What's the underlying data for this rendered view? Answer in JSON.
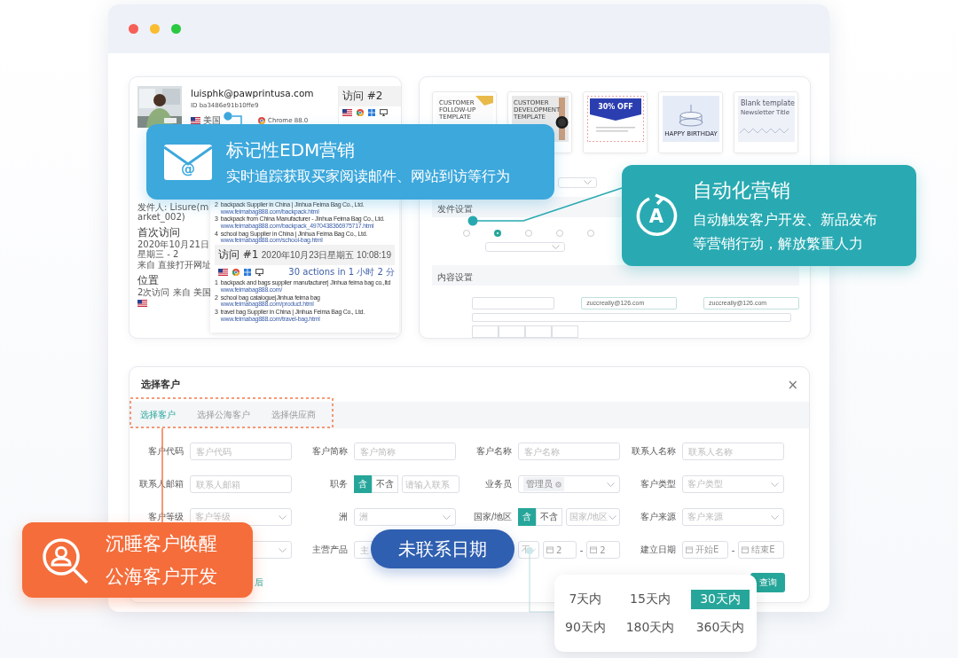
{
  "window": {
    "controls": [
      {
        "color": "#f65f57"
      },
      {
        "color": "#f9bd2f"
      },
      {
        "color": "#2ac940"
      }
    ]
  },
  "visitor_panel": {
    "email": "luisphk@pawprintusa.com",
    "id": "ID ba3486e91b10ffe9",
    "country": "美国",
    "browser": "Chrome 88.0",
    "sender": "发件人: Lisure(market_002)",
    "sections": [
      {
        "title": "首次访问",
        "lines": [
          "2020年10月21日星期三 - 2",
          "来自 直接打开网址"
        ],
        "flag": false
      },
      {
        "title": "位置",
        "lines": [
          "2次访问 来自 美国"
        ],
        "flag": true
      }
    ],
    "visit_2": {
      "title": "访问 #2"
    },
    "pages_top": [
      {
        "index": "2",
        "title": "backpack Supplier in China | Jinhua Feima Bag Co., Ltd.",
        "url": "www.feimabag888.com/backpack.html"
      },
      {
        "index": "3",
        "title": "backpack from China Manufacturer - Jinhua Feima Bag Co., Ltd.",
        "url": "www.feimabag888.com/backpack_4970438366975717.html"
      },
      {
        "index": "4",
        "title": "school bag Supplier in China | Jinhua Feima Bag Co., Ltd.",
        "url": "www.feimabag888.com/school-bag.html"
      }
    ],
    "visit_1": {
      "title": "访问 #1",
      "date": "2020年10月23日星期五 10:08:19",
      "summary": "30 actions in 1 小时 2 分",
      "pages": [
        {
          "index": "1",
          "title": "backpack and bags supplier manufacturer| Jinhua feima bag co.,ltd",
          "url": "www.feimabag888.com/"
        },
        {
          "index": "2",
          "title": "school bag catalogue|Jinhua feima bag",
          "url": "www.feimabag888.com/product.html"
        },
        {
          "index": "3",
          "title": "travel bag Supplier in China | Jinhua Feima Bag Co., Ltd.",
          "url": "www.feimabag888.com/travel-bag.html"
        }
      ]
    }
  },
  "campaign_panel": {
    "templates": [
      {
        "kind": "followup",
        "texts": [
          "CUSTOMER",
          "FOLLOW-UP",
          "TEMPLATE"
        ]
      },
      {
        "kind": "development",
        "texts": [
          "CUSTOMER",
          "DEVELOPMENT",
          "TEMPLATE"
        ]
      },
      {
        "kind": "sale",
        "texts": [
          "30% OFF"
        ]
      },
      {
        "kind": "birthday",
        "texts": [
          "HAPPY BIRTHDAY"
        ]
      },
      {
        "kind": "blank",
        "texts": [
          "Blank template",
          "Newsletter Title"
        ]
      }
    ],
    "sections": [
      {
        "title": "发件设置"
      },
      {
        "title": "内容设置"
      }
    ],
    "radios": [
      {
        "selected": false
      },
      {
        "selected": true
      },
      {
        "selected": false
      },
      {
        "selected": false
      },
      {
        "selected": false
      }
    ],
    "sender_addresses": [
      "zuccreally@126.com",
      "zuccreally@126.com"
    ]
  },
  "customer_dialog": {
    "title": "选择客户",
    "close": "×",
    "tabs": [
      {
        "label": "选择客户",
        "selected": true
      },
      {
        "label": "选择公海客户",
        "selected": false
      },
      {
        "label": "选择供应商",
        "selected": false
      }
    ],
    "fields": [
      {
        "kind": "input",
        "label": "客户代码",
        "placeholder": "客户代码"
      },
      {
        "kind": "input",
        "label": "客户简称",
        "placeholder": "客户简称"
      },
      {
        "kind": "input",
        "label": "客户名称",
        "placeholder": "客户名称"
      },
      {
        "kind": "input",
        "label": "联系人名称",
        "placeholder": "联系人名称"
      },
      {
        "kind": "input",
        "label": "联系人邮箱",
        "placeholder": "联系人邮箱"
      },
      {
        "kind": "toggle_input",
        "label": "职务",
        "options": [
          {
            "label": "含",
            "selected": true
          },
          {
            "label": "不含",
            "selected": false
          }
        ],
        "placeholder": "请输入联系"
      },
      {
        "kind": "tag_select",
        "label": "业务员",
        "tag": "管理员"
      },
      {
        "kind": "select",
        "label": "客户类型",
        "placeholder": "客户类型"
      },
      {
        "kind": "select",
        "label": "客户等级",
        "placeholder": "客户等级"
      },
      {
        "kind": "select",
        "label": "洲",
        "placeholder": "洲"
      },
      {
        "kind": "toggle_select",
        "label": "国家/地区",
        "options": [
          {
            "label": "含",
            "selected": true
          },
          {
            "label": "不含",
            "selected": false
          }
        ],
        "placeholder": "国家/地区"
      },
      {
        "kind": "select",
        "label": "客户来源",
        "placeholder": "客户来源"
      },
      {
        "kind": "select"
      },
      {
        "kind": "input",
        "label": "主营产品",
        "placeholder": "主"
      },
      {
        "kind": "date_range",
        "select": "不",
        "start": "2",
        "separator": "-",
        "end": "2"
      },
      {
        "kind": "date_range",
        "label": "建立日期",
        "start": "开始E",
        "separator": "-",
        "end": "结束E"
      }
    ],
    "link": "后",
    "search_button": "查询"
  },
  "callouts": [
    {
      "kind": "edm",
      "title": "标记性EDM营销",
      "lines": [
        "实时追踪获取买家阅读邮件、网站到访等行为"
      ],
      "icon_text": "@"
    },
    {
      "kind": "automation",
      "title": "自动化营销",
      "lines": [
        "自动触发客户开发、新品发布",
        "等营销行动，解放繁重人力"
      ],
      "icon_text": "A"
    },
    {
      "kind": "reactivation",
      "lines": [
        "沉睡客户唤醒",
        "公海客户开发"
      ]
    },
    {
      "kind": "date_label",
      "title": "未联系日期"
    }
  ],
  "date_popup": {
    "ranges": [
      {
        "label": "7天内",
        "selected": false
      },
      {
        "label": "15天内",
        "selected": false
      },
      {
        "label": "30天内",
        "selected": true
      },
      {
        "label": "90天内",
        "selected": false
      },
      {
        "label": "180天内",
        "selected": false
      },
      {
        "label": "360天内",
        "selected": false
      }
    ]
  }
}
